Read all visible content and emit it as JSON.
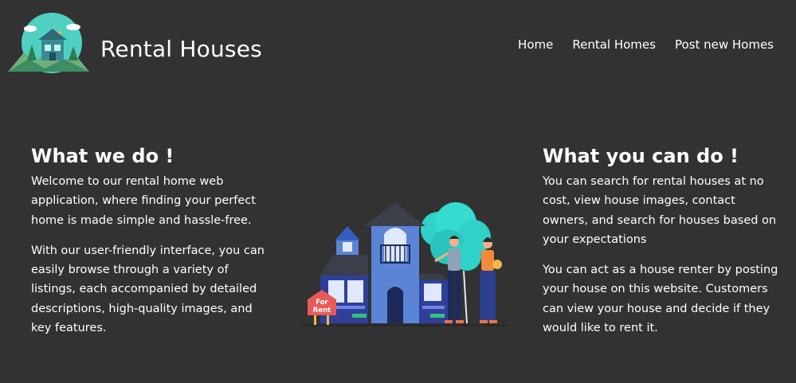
{
  "header": {
    "title": "Rental Houses",
    "nav": [
      {
        "label": "Home"
      },
      {
        "label": "Rental Homes"
      },
      {
        "label": "Post new Homes"
      }
    ]
  },
  "sections": {
    "what_we_do": {
      "heading": "What we do !",
      "paragraphs": [
        "Welcome to our rental home web application, where finding your perfect home is made simple and hassle-free.",
        "With our user-friendly interface, you can easily browse through a variety of listings, each accompanied by detailed descriptions, high-quality images, and key features."
      ]
    },
    "what_you_can_do": {
      "heading": "What you can do !",
      "paragraphs": [
        "You can search for rental houses at no cost, view house images, contact owners, and search for houses based on your expectations",
        "You can act as a house renter by posting your house on this website. Customers can view your house and decide if they would like to rent it."
      ]
    }
  },
  "illustration": {
    "sign_line1": "For",
    "sign_line2": "Rent"
  },
  "colors": {
    "background": "#323232",
    "text": "#ffffff",
    "house_blue": "#5b84d6",
    "house_dark": "#2c3e8c",
    "tree_teal": "#2fd1c9",
    "sign_red": "#e85a5a"
  },
  "icons": {
    "logo": "house-logo-icon"
  }
}
